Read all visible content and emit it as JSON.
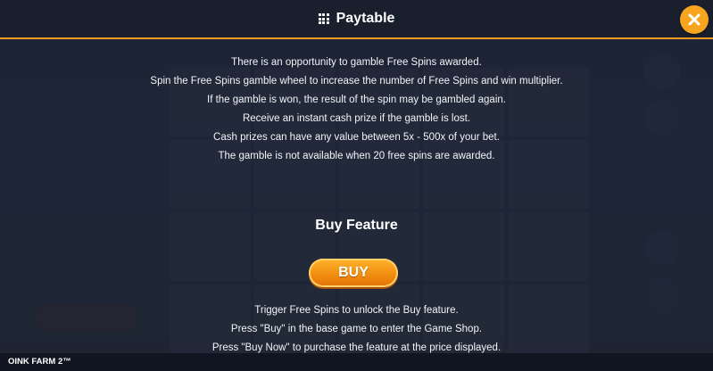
{
  "header": {
    "title": "Paytable",
    "menu_icon": "grid-icon",
    "close_icon": "close-icon",
    "accent_color": "#f29a1f"
  },
  "gamble_rules": [
    "There is an opportunity to gamble Free Spins awarded.",
    "Spin the Free Spins gamble wheel to increase the number of Free Spins and win multiplier.",
    "If the gamble is won, the result of the spin may be gambled again.",
    "Receive an instant cash prize if the gamble is lost.",
    "Cash prizes can have any value between 5x - 500x of your bet.",
    "The gamble is not available when 20 free spins are awarded."
  ],
  "buy_feature": {
    "title": "Buy Feature",
    "button_label": "BUY",
    "lines": [
      "Trigger Free Spins to unlock the Buy feature.",
      "Press \"Buy\" in the base game to enter the Game Shop.",
      "Press \"Buy Now\" to purchase the feature at the price displayed."
    ]
  },
  "footer": {
    "game_name": "OINK FARM 2™"
  }
}
